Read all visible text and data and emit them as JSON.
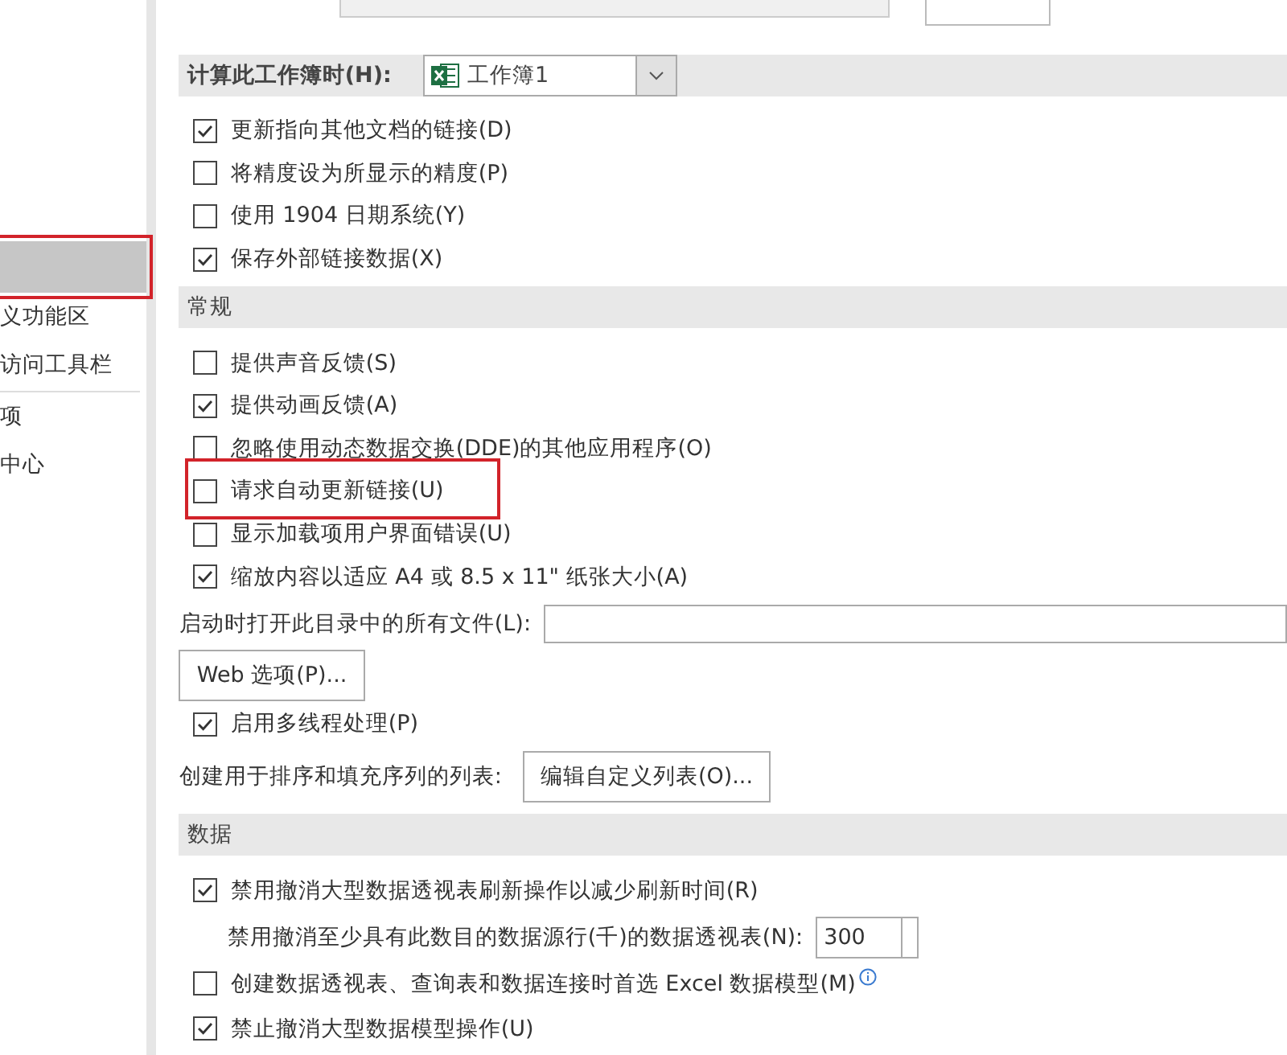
{
  "sidebar": {
    "items": [
      {
        "selected": true,
        "highlighted": true
      },
      {
        "label": "义功能区",
        "selected": false,
        "highlighted": false
      },
      {
        "label": "访问工具栏",
        "selected": false,
        "highlighted": false
      },
      {
        "label": "项",
        "selected": false,
        "highlighted": false
      },
      {
        "label": "中心",
        "selected": false,
        "highlighted": false
      }
    ]
  },
  "workbook": {
    "label": "计算此工作簿时(H):",
    "value": "工作簿1",
    "items": [
      {
        "label": "更新指向其他文档的链接(D)",
        "checked": true
      },
      {
        "label": "将精度设为所显示的精度(P)",
        "checked": false
      },
      {
        "label": "使用 1904 日期系统(Y)",
        "checked": false
      },
      {
        "label": "保存外部链接数据(X)",
        "checked": true
      }
    ]
  },
  "general": {
    "title": "常规",
    "items": [
      {
        "kind": "checkbox",
        "label": "提供声音反馈(S)",
        "checked": false,
        "highlighted": false
      },
      {
        "kind": "checkbox",
        "label": "提供动画反馈(A)",
        "checked": true,
        "highlighted": false
      },
      {
        "kind": "checkbox",
        "label": "忽略使用动态数据交换(DDE)的其他应用程序(O)",
        "checked": false,
        "highlighted": false
      },
      {
        "kind": "checkbox",
        "label": "请求自动更新链接(U)",
        "checked": false,
        "highlighted": true
      },
      {
        "kind": "checkbox",
        "label": "显示加载项用户界面错误(U)",
        "checked": false,
        "highlighted": false
      },
      {
        "kind": "checkbox",
        "label": "缩放内容以适应 A4 或 8.5 x 11\" 纸张大小(A)",
        "checked": true,
        "highlighted": false
      },
      {
        "kind": "field",
        "label": "启动时打开此目录中的所有文件(L):"
      },
      {
        "kind": "button",
        "button": "Web 选项(P)..."
      },
      {
        "kind": "checkbox",
        "label": "启用多线程处理(P)",
        "checked": true,
        "highlighted": false
      },
      {
        "kind": "labeled-button",
        "label": "创建用于排序和填充序列的列表:",
        "button": "编辑自定义列表(O)..."
      }
    ]
  },
  "data": {
    "title": "数据",
    "items": [
      {
        "kind": "checkbox",
        "label": "禁用撤消大型数据透视表刷新操作以减少刷新时间(R)",
        "checked": true
      },
      {
        "kind": "spin",
        "label": "禁用撤消至少具有此数目的数据源行(千)的数据透视表(N):",
        "value": "300"
      },
      {
        "kind": "checkbox",
        "label": "创建数据透视表、查询表和数据连接时首选 Excel 数据模型(M)",
        "checked": false,
        "info": true
      },
      {
        "kind": "checkbox",
        "label": "禁止撤消大型数据模型操作(U)",
        "checked": true
      }
    ]
  }
}
